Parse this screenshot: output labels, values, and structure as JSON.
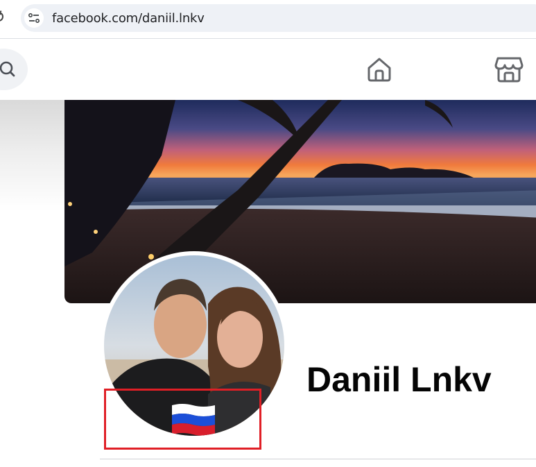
{
  "browser": {
    "url": "facebook.com/daniil.lnkv",
    "icons": [
      "reload-icon",
      "site-info-icon"
    ]
  },
  "header": {
    "icons": [
      "search-icon",
      "home-icon",
      "marketplace-icon"
    ]
  },
  "profile": {
    "name": "Daniil Lnkv",
    "cover_photo": "beach-sunset-palm-trees",
    "avatar": "couple-photo-with-russian-flag-overlay",
    "flag": "russia-flag"
  },
  "annotation": {
    "highlight_color": "#e01f26"
  },
  "colors": {
    "surface": "#f0f2f5",
    "divider": "#ced0d4",
    "text": "#050505"
  }
}
